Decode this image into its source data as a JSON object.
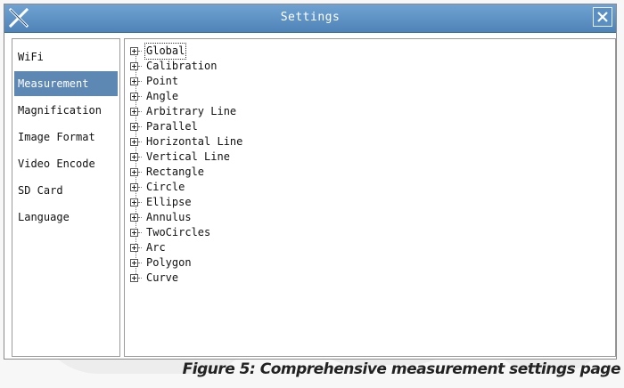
{
  "window": {
    "title": "Settings"
  },
  "sidebar": {
    "selected_index": 1,
    "items": [
      {
        "label": "WiFi"
      },
      {
        "label": "Measurement"
      },
      {
        "label": "Magnification"
      },
      {
        "label": "Image Format"
      },
      {
        "label": "Video Encode"
      },
      {
        "label": "SD Card"
      },
      {
        "label": "Language"
      }
    ]
  },
  "tree": {
    "focused_index": 0,
    "items": [
      {
        "label": "Global"
      },
      {
        "label": "Calibration"
      },
      {
        "label": "Point"
      },
      {
        "label": "Angle"
      },
      {
        "label": "Arbitrary Line"
      },
      {
        "label": "Parallel"
      },
      {
        "label": "Horizontal Line"
      },
      {
        "label": "Vertical Line"
      },
      {
        "label": "Rectangle"
      },
      {
        "label": "Circle"
      },
      {
        "label": "Ellipse"
      },
      {
        "label": "Annulus"
      },
      {
        "label": "TwoCircles"
      },
      {
        "label": "Arc"
      },
      {
        "label": "Polygon"
      },
      {
        "label": "Curve"
      }
    ]
  },
  "caption": "Figure 5: Comprehensive measurement settings page",
  "colors": {
    "titlebar": "#5a8fc4",
    "selection": "#5e88b4"
  }
}
